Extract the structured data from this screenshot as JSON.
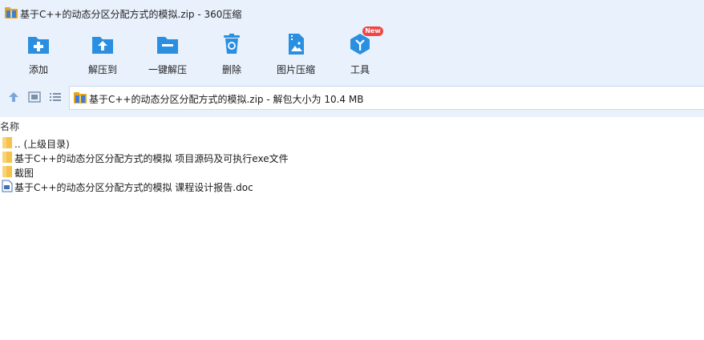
{
  "window": {
    "title": "基于C++的动态分区分配方式的模拟.zip - 360压缩"
  },
  "toolbar": {
    "items": [
      {
        "label": "添加",
        "icon": "add-icon"
      },
      {
        "label": "解压到",
        "icon": "extract-to-icon"
      },
      {
        "label": "一键解压",
        "icon": "one-click-extract-icon"
      },
      {
        "label": "删除",
        "icon": "delete-icon"
      },
      {
        "label": "图片压缩",
        "icon": "image-compress-icon"
      },
      {
        "label": "工具",
        "icon": "tools-icon"
      }
    ],
    "badge": "New"
  },
  "nav": {
    "address": "基于C++的动态分区分配方式的模拟.zip - 解包大小为 10.4 MB"
  },
  "columns": {
    "name": "名称"
  },
  "files": [
    {
      "name": ".. (上级目录)",
      "type": "folder"
    },
    {
      "name": "基于C++的动态分区分配方式的模拟 项目源码及可执行exe文件",
      "type": "folder"
    },
    {
      "name": "截图",
      "type": "folder"
    },
    {
      "name": "基于C++的动态分区分配方式的模拟 课程设计报告.doc",
      "type": "doc"
    }
  ],
  "colors": {
    "accent": "#2a8fe0",
    "toolbar_bg": "#e8f1fc",
    "badge": "#f04646"
  }
}
